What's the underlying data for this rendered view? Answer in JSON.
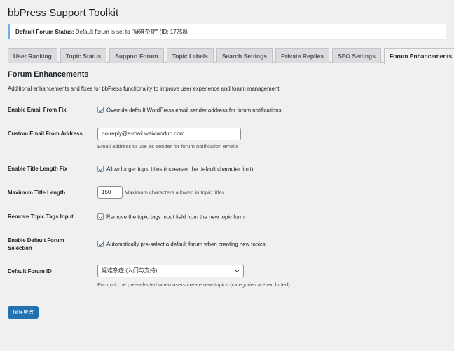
{
  "page": {
    "title": "bbPress Support Toolkit"
  },
  "notice": {
    "label": "Default Forum Status:",
    "text": "Default forum is set to \"疑难杂症\" (ID: 17758)"
  },
  "tabs": [
    {
      "label": "User Ranking",
      "active": false
    },
    {
      "label": "Topic Status",
      "active": false
    },
    {
      "label": "Support Forum",
      "active": false
    },
    {
      "label": "Topic Labels",
      "active": false
    },
    {
      "label": "Search Settings",
      "active": false
    },
    {
      "label": "Private Replies",
      "active": false
    },
    {
      "label": "SEO Settings",
      "active": false
    },
    {
      "label": "Forum Enhancements",
      "active": true
    }
  ],
  "section": {
    "title": "Forum Enhancements",
    "description": "Additional enhancements and fixes for bbPress functionality to improve user experience and forum management."
  },
  "settings": {
    "email_fix": {
      "label": "Enable Email From Fix",
      "checked": true,
      "text": "Override default WordPress email sender address for forum notifications"
    },
    "custom_email": {
      "label": "Custom Email From Address",
      "value": "no-reply@e-mail.weixiaoduo.com",
      "help": "Email address to use as sender for forum notification emails"
    },
    "title_fix": {
      "label": "Enable Title Length Fix",
      "checked": true,
      "text": "Allow longer topic titles (increases the default character limit)"
    },
    "max_title": {
      "label": "Maximum Title Length",
      "value": "150",
      "help": "Maximum characters allowed in topic titles"
    },
    "remove_tags": {
      "label": "Remove Topic Tags Input",
      "checked": true,
      "text": "Remove the topic tags input field from the new topic form"
    },
    "default_forum_sel": {
      "label": "Enable Default Forum Selection",
      "checked": true,
      "text": "Automatically pre-select a default forum when creating new topics"
    },
    "default_forum_id": {
      "label": "Default Forum ID",
      "selected": "疑难杂症 (入门与支持)",
      "help": "Forum to be pre-selected when users create new topics (categories are excluded)"
    }
  },
  "save_button": "保存更改",
  "colors": {
    "accent": "#2271b1",
    "notice_border": "#72aee6"
  }
}
